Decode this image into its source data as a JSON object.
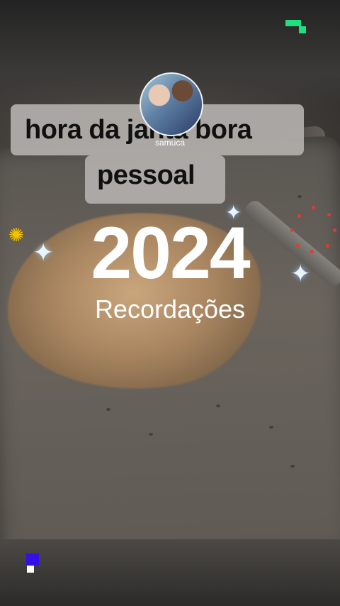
{
  "caption": {
    "line1": "hora da janta bora",
    "line2": "pessoal"
  },
  "profile": {
    "name": "samuca"
  },
  "overlay": {
    "year": "2024",
    "subtitle": "Recordações"
  },
  "icons": {
    "sparkle": "sparkle-icon",
    "sun": "sun-sticker-icon",
    "firework": "firework-icon"
  },
  "colors": {
    "caption_bg": "#b1aeab",
    "caption_text": "#101010",
    "title_text": "#ffffff",
    "accent_green": "#1fe07e",
    "accent_blue": "#3510e6"
  }
}
